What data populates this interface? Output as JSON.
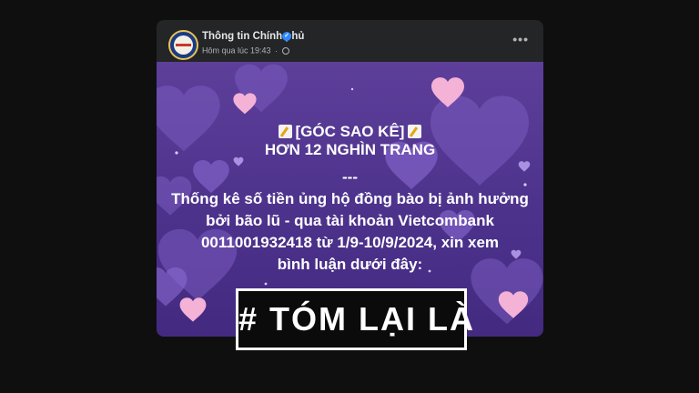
{
  "post": {
    "page_name": "Thông tin Chính phủ",
    "time": "Hôm qua lúc 19:43",
    "separator": "·",
    "more_label": "•••",
    "verified_icon": "verified-badge-icon",
    "privacy_icon": "globe-icon",
    "avatar_icon": "government-seal-icon"
  },
  "image": {
    "line1": "[GÓC SAO KÊ]",
    "line2": "HƠN 12 NGHÌN TRANG",
    "line3": "---",
    "line4": "Thống kê số tiền ủng hộ đồng bào bị ảnh hưởng",
    "line5": "bởi bão lũ - qua tài khoản Vietcombank",
    "line6": "0011001932418 từ 1/9-10/9/2024, xin xem",
    "line7": "bình luận dưới đây:",
    "decor_icon": "heart-icon",
    "bg_color": "#5d3f9a"
  },
  "overlay": {
    "hashtag": "# TÓM LẠI LÀ"
  }
}
